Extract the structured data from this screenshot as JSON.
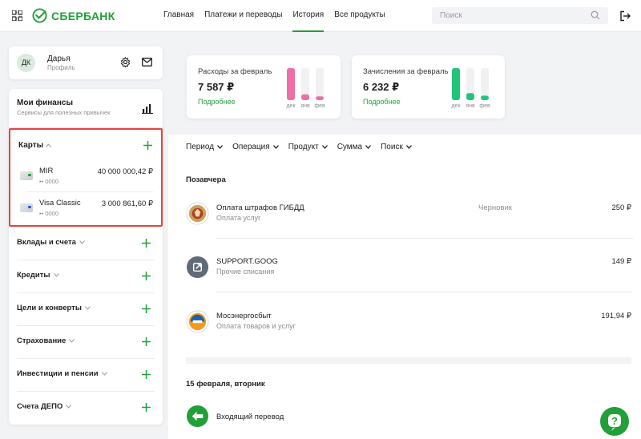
{
  "header": {
    "brand": "СБЕРБАНК",
    "nav": [
      "Главная",
      "Платежи и переводы",
      "История",
      "Все продукты"
    ],
    "active_nav": "История",
    "search_placeholder": "Поиск",
    "accent": "#21a038"
  },
  "profile": {
    "initials": "ДК",
    "name": "Дарья",
    "subtitle": "Профиль"
  },
  "finances": {
    "title": "Мои финансы",
    "subtitle": "Сервисы для полезных привычек"
  },
  "cards": {
    "title": "Карты",
    "items": [
      {
        "name": "MIR",
        "number": "•• 0000",
        "amount": "40 000 000,42 ₽"
      },
      {
        "name": "Visa Classic",
        "number": "•• 0000",
        "amount": "3 000 861,60 ₽"
      }
    ]
  },
  "sections": [
    "Вклады и счета",
    "Кредиты",
    "Цели и конверты",
    "Страхование",
    "Инвестиции и пенсии",
    "Счета ДЕПО"
  ],
  "summary": [
    {
      "label": "Расходы за февраль",
      "value": "7 587 ₽",
      "link": "Подробнее",
      "bar_color": "#f06ea8",
      "months": [
        "дек",
        "янв",
        "фев"
      ],
      "levels": [
        1.0,
        0.18,
        0.12
      ]
    },
    {
      "label": "Зачисления за февраль",
      "value": "6 232 ₽",
      "link": "Подробнее",
      "bar_color": "#21c57a",
      "months": [
        "дек",
        "янв",
        "фев"
      ],
      "levels": [
        1.0,
        0.22,
        0.14
      ]
    }
  ],
  "filters": [
    "Период",
    "Операция",
    "Продукт",
    "Сумма",
    "Поиск"
  ],
  "groups": [
    {
      "title": "Позавчера",
      "transactions": [
        {
          "name": "Оплата штрафов ГИБДД",
          "category": "Оплата услуг",
          "status": "Черновик",
          "amount": "250 ₽",
          "icon": "gibdd-emblem-icon"
        },
        {
          "name": "SUPPORT.GOOG",
          "category": "Прочие списания",
          "status": "",
          "amount": "149 ₽",
          "icon": "arrow-out-icon"
        },
        {
          "name": "Мосэнергосбыт",
          "category": "Оплата товаров и услуг",
          "status": "",
          "amount": "191,94 ₽",
          "icon": "mosenergosbyt-logo-icon"
        }
      ]
    },
    {
      "title": "15 февраля, вторник",
      "transactions": [
        {
          "name": "Входящий перевод",
          "category": "",
          "status": "",
          "amount": "₽",
          "icon": "incoming-transfer-icon"
        }
      ]
    }
  ]
}
